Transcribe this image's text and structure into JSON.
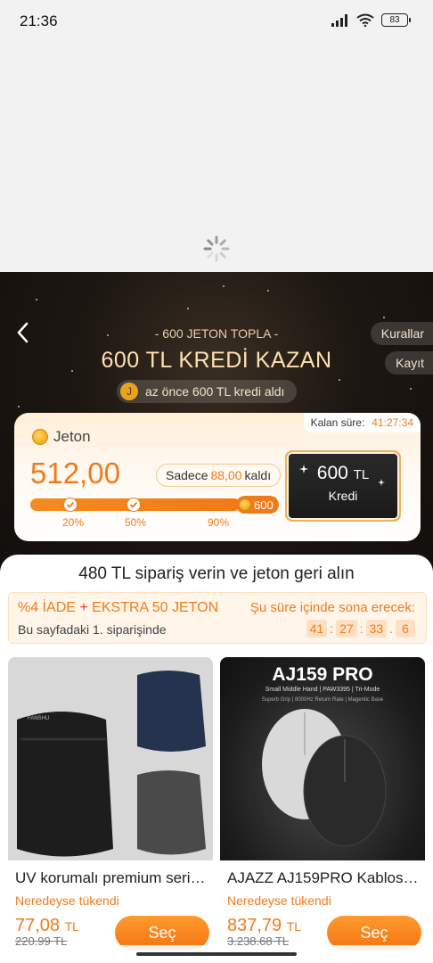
{
  "status_bar": {
    "time": "21:36",
    "battery": "83"
  },
  "header": {
    "subtitle": "- 600 JETON TOPLA -",
    "title": "600 TL KREDİ KAZAN",
    "rules_label": "Kurallar",
    "record_label": "Kayıt",
    "notice_avatar": "J",
    "notice_text": "az önce 600 TL kredi aldı"
  },
  "jeton": {
    "deadline_label": "Kalan süre:",
    "deadline_value": "41:27:34",
    "label": "Jeton",
    "amount": "512,00",
    "remain_prefix": "Sadece",
    "remain_amount": "88,00",
    "remain_suffix": "kaldı",
    "progress_fraction": 0.85,
    "milestones": [
      "20%",
      "50%",
      "90%"
    ],
    "goal_label": "600",
    "credit_amount": "600",
    "credit_currency": "TL",
    "credit_label": "Kredi"
  },
  "promo": {
    "title": "480 TL sipariş verin ve jeton geri alın",
    "head_refund": "%4 İADE",
    "head_plus": "+",
    "head_extra": "EKSTRA 50 JETON",
    "sub": "Bu sayfadaki 1. siparişinde",
    "ends_label": "Şu süre içinde sona erecek:",
    "countdown": [
      "41",
      "27",
      "33",
      "6"
    ]
  },
  "products": [
    {
      "name": "UV korumalı premium seri…",
      "status": "Neredeyse tükendi",
      "price": "77,08",
      "currency": "TL",
      "old_price": "220,99 TL",
      "button": "Seç",
      "brand_text": "FANSHU"
    },
    {
      "name": "AJAZZ AJ159PRO Kablos…",
      "status": "Neredeyse tükendi",
      "price": "837,79",
      "currency": "TL",
      "old_price": "3.238,68 TL",
      "button": "Seç",
      "banner_title": "AJ159 PRO",
      "banner_sub": "Small Middle Hand | PAW3395 | Tri-Mode",
      "banner_sub2": "Superb Grip | 8000Hz Return Rate | Magentic Base"
    }
  ],
  "colors": {
    "accent": "#f07b1c",
    "hero_bg": "#1d1712",
    "sheet_bg": "#ffffff"
  }
}
